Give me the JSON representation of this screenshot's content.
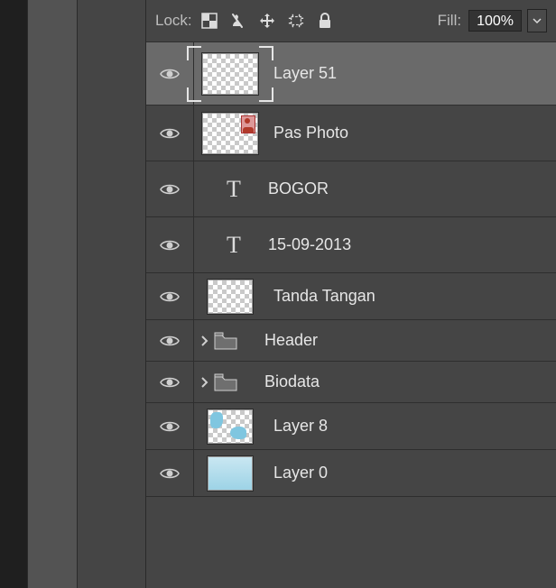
{
  "lockbar": {
    "label": "Lock:",
    "fill_label": "Fill:",
    "fill_value": "100%"
  },
  "layers": [
    {
      "name": "Layer 51",
      "kind": "pixel",
      "selected": true
    },
    {
      "name": "Pas Photo",
      "kind": "pixel",
      "photo": true
    },
    {
      "name": "BOGOR",
      "kind": "text"
    },
    {
      "name": "15-09-2013",
      "kind": "text"
    },
    {
      "name": "Tanda Tangan",
      "kind": "pixel"
    },
    {
      "name": "Header",
      "kind": "group"
    },
    {
      "name": "Biodata",
      "kind": "group"
    },
    {
      "name": "Layer 8",
      "kind": "pixel",
      "blotch": true
    },
    {
      "name": "Layer 0",
      "kind": "pixel",
      "card": true
    }
  ]
}
